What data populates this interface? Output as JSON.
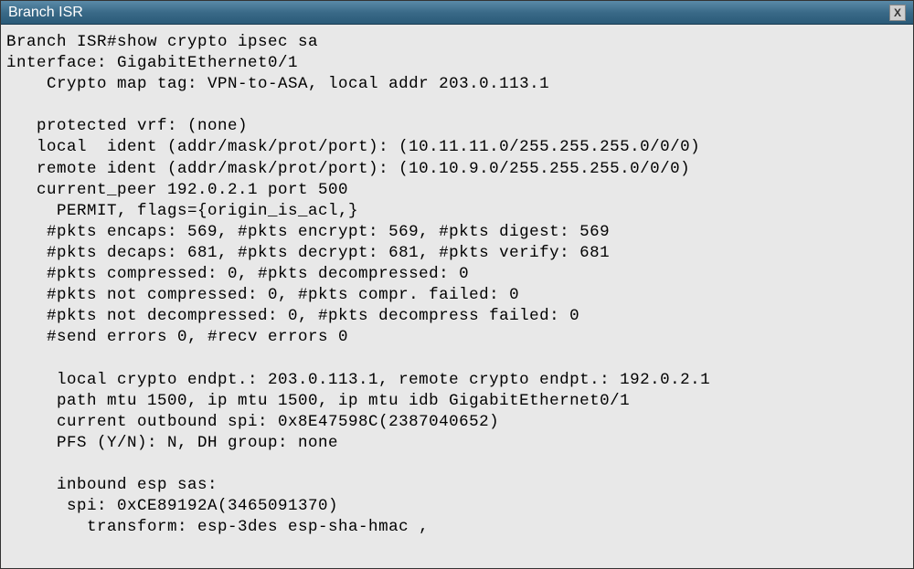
{
  "window": {
    "title": "Branch ISR",
    "close_label": "X"
  },
  "terminal": {
    "prompt": "Branch ISR#",
    "command": "show crypto ipsec sa",
    "lines": {
      "l0": "Branch ISR#show crypto ipsec sa",
      "l1": "interface: GigabitEthernet0/1",
      "l2": "    Crypto map tag: VPN-to-ASA, local addr 203.0.113.1",
      "l3": "",
      "l4": "   protected vrf: (none)",
      "l5": "   local  ident (addr/mask/prot/port): (10.11.11.0/255.255.255.0/0/0)",
      "l6": "   remote ident (addr/mask/prot/port): (10.10.9.0/255.255.255.0/0/0)",
      "l7": "   current_peer 192.0.2.1 port 500",
      "l8": "     PERMIT, flags={origin_is_acl,}",
      "l9": "    #pkts encaps: 569, #pkts encrypt: 569, #pkts digest: 569",
      "l10": "    #pkts decaps: 681, #pkts decrypt: 681, #pkts verify: 681",
      "l11": "    #pkts compressed: 0, #pkts decompressed: 0",
      "l12": "    #pkts not compressed: 0, #pkts compr. failed: 0",
      "l13": "    #pkts not decompressed: 0, #pkts decompress failed: 0",
      "l14": "    #send errors 0, #recv errors 0",
      "l15": "",
      "l16": "     local crypto endpt.: 203.0.113.1, remote crypto endpt.: 192.0.2.1",
      "l17": "     path mtu 1500, ip mtu 1500, ip mtu idb GigabitEthernet0/1",
      "l18": "     current outbound spi: 0x8E47598C(2387040652)",
      "l19": "     PFS (Y/N): N, DH group: none",
      "l20": "",
      "l21": "     inbound esp sas:",
      "l22": "      spi: 0xCE89192A(3465091370)",
      "l23": "        transform: esp-3des esp-sha-hmac ,"
    }
  },
  "ipsec_sa_data": {
    "interface": "GigabitEthernet0/1",
    "crypto_map_tag": "VPN-to-ASA",
    "local_addr": "203.0.113.1",
    "protected_vrf": "(none)",
    "local_ident": "10.11.11.0/255.255.255.0/0/0",
    "remote_ident": "10.10.9.0/255.255.255.0/0/0",
    "current_peer": "192.0.2.1",
    "current_peer_port": 500,
    "flags": "origin_is_acl",
    "pkts_encaps": 569,
    "pkts_encrypt": 569,
    "pkts_digest": 569,
    "pkts_decaps": 681,
    "pkts_decrypt": 681,
    "pkts_verify": 681,
    "pkts_compressed": 0,
    "pkts_decompressed": 0,
    "pkts_not_compressed": 0,
    "pkts_compr_failed": 0,
    "pkts_not_decompressed": 0,
    "pkts_decompress_failed": 0,
    "send_errors": 0,
    "recv_errors": 0,
    "local_crypto_endpt": "203.0.113.1",
    "remote_crypto_endpt": "192.0.2.1",
    "path_mtu": 1500,
    "ip_mtu": 1500,
    "ip_mtu_idb": "GigabitEthernet0/1",
    "outbound_spi_hex": "0x8E47598C",
    "outbound_spi_dec": 2387040652,
    "pfs": "N",
    "dh_group": "none",
    "inbound_esp_spi_hex": "0xCE89192A",
    "inbound_esp_spi_dec": 3465091370,
    "inbound_transform": "esp-3des esp-sha-hmac"
  }
}
